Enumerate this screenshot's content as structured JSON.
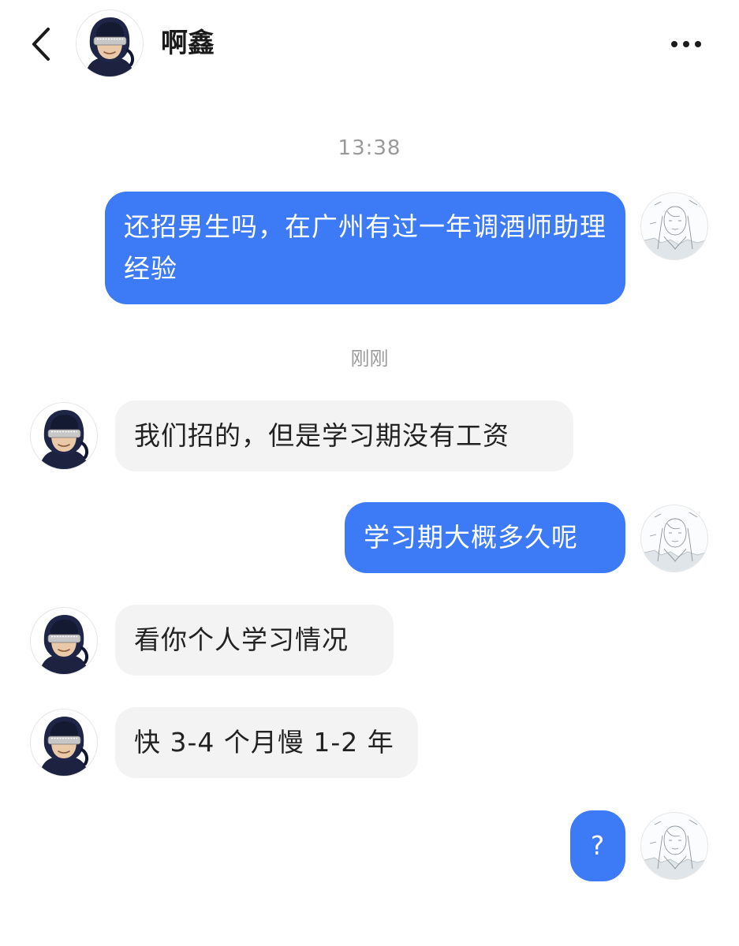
{
  "header": {
    "back_icon": "chevron-left-icon",
    "contact_name": "啊鑫",
    "more_icon": "more-horizontal-icon"
  },
  "colors": {
    "outgoing_bubble": "#3d7af5",
    "incoming_bubble": "#f3f3f3",
    "timestamp_text": "#9a9a9a"
  },
  "chat": {
    "timestamps": [
      "13:38",
      "刚刚"
    ],
    "messages": [
      {
        "direction": "outgoing",
        "text": "还招男生吗，在广州有过一年调酒师助理经验"
      },
      {
        "direction": "incoming",
        "text": "我们招的，但是学习期没有工资"
      },
      {
        "direction": "outgoing",
        "text": "学习期大概多久呢"
      },
      {
        "direction": "incoming",
        "text": "看你个人学习情况"
      },
      {
        "direction": "incoming",
        "text": "快 3-4 个月慢 1-2 年"
      },
      {
        "direction": "outgoing",
        "text": "?"
      }
    ]
  }
}
